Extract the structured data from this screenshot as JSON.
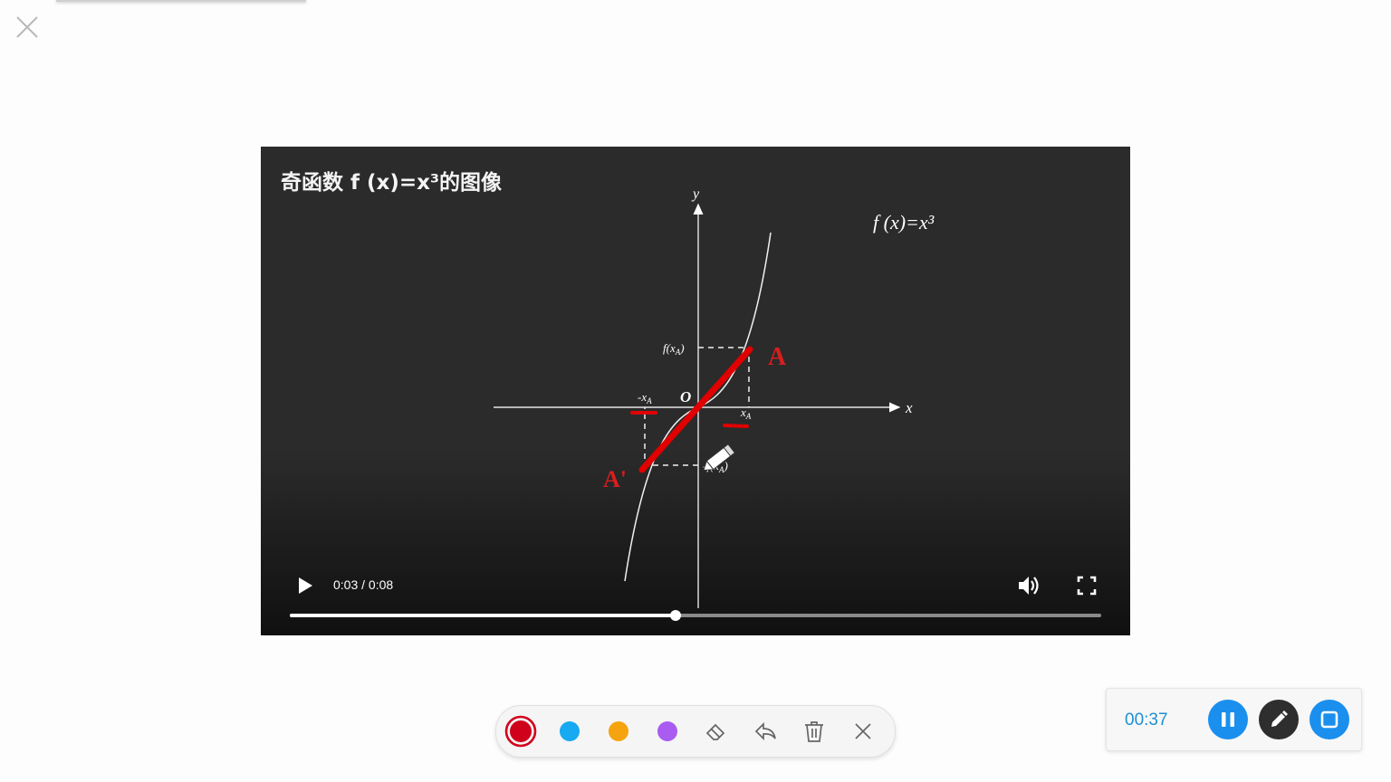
{
  "video": {
    "title": "奇函数 f (x)=x³的图像",
    "function_label": "f (x)=x³",
    "axis_x": "x",
    "axis_y": "y",
    "origin": "O",
    "label_fxa": "f(x",
    "label_fxa_sub": "A",
    "label_fxa_close": ")",
    "label_neg_xa": "-x",
    "label_neg_xa_sub": "A",
    "label_xa": "x",
    "label_xa_sub": "A",
    "label_neg_fxa": "-f(x",
    "label_neg_fxa_sub": "A",
    "label_neg_fxa_close": ")",
    "point_a": "A",
    "point_a_prime": "A'",
    "time_display": "0:03 / 0:08",
    "progress": 0.476
  },
  "toolbar": {
    "colors": [
      {
        "name": "red",
        "hex": "#d0021b",
        "selected": true
      },
      {
        "name": "blue",
        "hex": "#17a9f2"
      },
      {
        "name": "orange",
        "hex": "#f5a30f"
      },
      {
        "name": "purple",
        "hex": "#a95cf0"
      }
    ],
    "icons": [
      "eraser-icon",
      "undo-icon",
      "trash-icon",
      "close-icon"
    ]
  },
  "recorder": {
    "elapsed": "00:37",
    "accent": "#1a8fee"
  },
  "annotation_color": "#e00000"
}
